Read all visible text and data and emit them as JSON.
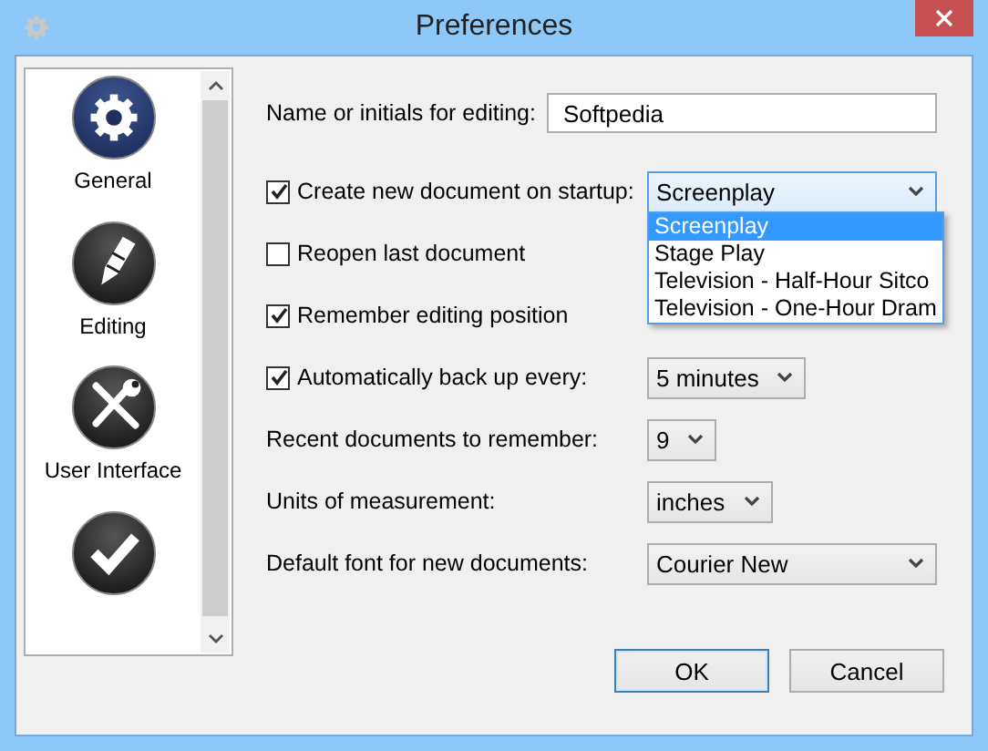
{
  "window": {
    "title": "Preferences"
  },
  "sidebar": {
    "items": [
      {
        "label": "General",
        "kind": "gear",
        "selected": true
      },
      {
        "label": "Editing",
        "kind": "pencil",
        "selected": false
      },
      {
        "label": "User Interface",
        "kind": "tools",
        "selected": false
      },
      {
        "kind": "check",
        "selected": false
      }
    ]
  },
  "settings": [
    {
      "kind": "label",
      "label": "Name or initials for editing:",
      "control": {
        "kind": "text",
        "value": "Softpedia"
      }
    },
    {
      "kind": "checkbox",
      "label": "Create new document on startup:",
      "checked": true,
      "control": {
        "kind": "combo",
        "value": "Screenplay",
        "open": true,
        "options": [
          {
            "label": "Screenplay",
            "selected": true
          },
          {
            "label": "Stage Play",
            "selected": false
          },
          {
            "label": "Television - Half-Hour Sitco",
            "selected": false
          },
          {
            "label": "Television - One-Hour Dram",
            "selected": false
          }
        ]
      }
    },
    {
      "kind": "checkbox",
      "label": "Reopen last document",
      "checked": false
    },
    {
      "kind": "checkbox",
      "label": "Remember editing position",
      "checked": true
    },
    {
      "kind": "checkbox",
      "label": "Automatically back up every:",
      "checked": true,
      "control": {
        "kind": "dropdown",
        "value": "5 minutes",
        "open": false
      }
    },
    {
      "kind": "label",
      "label": "Recent documents to remember:",
      "control": {
        "kind": "dropdown",
        "value": "9",
        "open": false
      }
    },
    {
      "kind": "label",
      "label": "Units of measurement:",
      "control": {
        "kind": "dropdown",
        "value": "inches",
        "open": false
      }
    },
    {
      "kind": "label",
      "label": "Default font for new documents:",
      "control": {
        "kind": "combo",
        "value": "Courier New",
        "open": false
      }
    }
  ],
  "buttons": [
    {
      "label": "OK",
      "focused": true
    },
    {
      "label": "Cancel",
      "focused": false
    }
  ]
}
